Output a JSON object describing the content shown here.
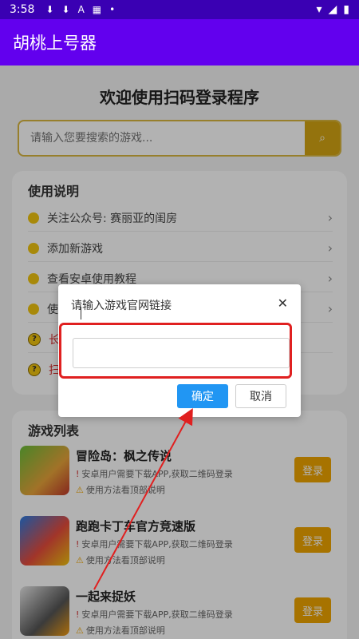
{
  "status_bar": {
    "time": "3:58"
  },
  "app_bar": {
    "title": "胡桃上号器"
  },
  "main": {
    "welcome": "欢迎使用扫码登录程序",
    "search": {
      "placeholder": "请输入您要搜索的游戏..."
    },
    "guide": {
      "title": "使用说明",
      "items": [
        {
          "label": "关注公众号: 赛丽亚的闺房"
        },
        {
          "label": "添加新游戏"
        },
        {
          "label": "查看安卓使用教程"
        },
        {
          "label": "使"
        },
        {
          "label": "长"
        },
        {
          "label": "扫"
        }
      ]
    },
    "games": {
      "title": "游戏列表",
      "items": [
        {
          "name": "冒险岛：枫之传说",
          "note1": "安卓用户需要下载APP,获取二维码登录",
          "note2": "使用方法看顶部说明",
          "button": "登录"
        },
        {
          "name": "跑跑卡丁车官方竞速版",
          "note1": "安卓用户需要下载APP,获取二维码登录",
          "note2": "使用方法看顶部说明",
          "button": "登录"
        },
        {
          "name": "一起来捉妖",
          "note1": "安卓用户需要下载APP,获取二维码登录",
          "note2": "使用方法看顶部说明",
          "button": "登录"
        }
      ]
    }
  },
  "dialog": {
    "title": "请输入游戏官网链接",
    "input_value": "",
    "ok_label": "确定",
    "cancel_label": "取消"
  },
  "colors": {
    "status_bar": "#3a00b3",
    "app_bar": "#6200ee",
    "accent": "#f0a500",
    "ok_button": "#2196f3",
    "highlight": "#e02020"
  },
  "icons": [
    "download-icon",
    "text-icon",
    "keyboard-icon",
    "wifi-icon",
    "signal-icon",
    "battery-icon",
    "search-icon",
    "bulb-icon",
    "question-icon",
    "chevron-right-icon",
    "close-icon",
    "warning-icon",
    "alert-icon"
  ]
}
